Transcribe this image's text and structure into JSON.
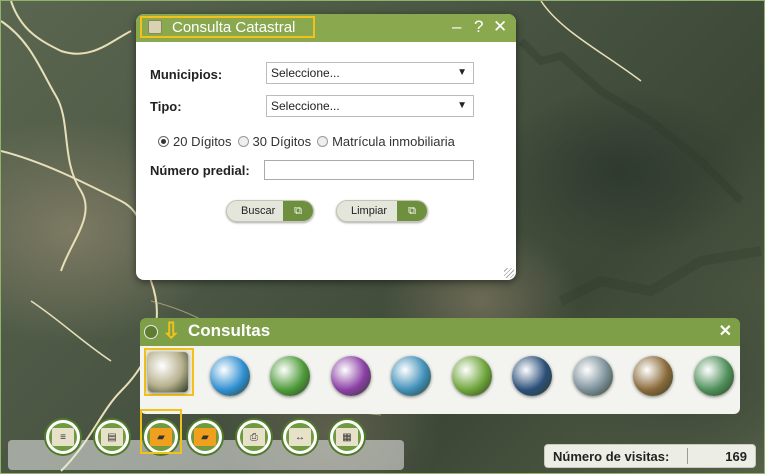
{
  "consulta_catastral": {
    "title": "Consulta Catastral",
    "help_label": "?",
    "minimize_label": "–",
    "close_label": "✕",
    "municipios_label": "Municipios:",
    "municipios_value": "Seleccione...",
    "tipo_label": "Tipo:",
    "tipo_value": "Seleccione...",
    "radio_options": [
      "20 Dígitos",
      "30 Dígitos",
      "Matrícula inmobiliaria"
    ],
    "radio_selected": "20 Dígitos",
    "numero_predial_label": "Número predial:",
    "numero_predial_value": "",
    "buscar_label": "Buscar",
    "limpiar_label": "Limpiar"
  },
  "consultas": {
    "title": "Consultas",
    "close_label": "✕",
    "tools": [
      {
        "name": "consulta-catastral-tool-icon",
        "color": "#b8b28f"
      },
      {
        "name": "search-tool-icon",
        "color": "#2f8fd1"
      },
      {
        "name": "bird-tool-icon",
        "color": "#4e9b39"
      },
      {
        "name": "theater-masks-tool-icon",
        "color": "#8a3fa5"
      },
      {
        "name": "doctor-tool-icon",
        "color": "#3f8fb8"
      },
      {
        "name": "magnifier-road-tool-icon",
        "color": "#6ea53a"
      },
      {
        "name": "network-tool-icon",
        "color": "#2b4f7a"
      },
      {
        "name": "factory-tool-icon",
        "color": "#7b8f99"
      },
      {
        "name": "house-tool-icon",
        "color": "#8a6a3a"
      },
      {
        "name": "people-chart-tool-icon",
        "color": "#4e8f5a"
      }
    ]
  },
  "dock": {
    "buttons": [
      {
        "name": "legend-icon",
        "glyph": "≡"
      },
      {
        "name": "layers-icon",
        "glyph": "▤"
      },
      {
        "name": "consultas-folder-icon",
        "glyph": "▰"
      },
      {
        "name": "open-folder-icon",
        "glyph": "▰"
      },
      {
        "name": "print-icon",
        "glyph": "⎙"
      },
      {
        "name": "measure-icon",
        "glyph": "↔"
      },
      {
        "name": "map-icon",
        "glyph": "▦"
      }
    ]
  },
  "visitas": {
    "label": "Número de visitas:",
    "value": "169"
  },
  "colors": {
    "header_green": "#8aa94f",
    "highlight_yellow": "#f2c21b"
  }
}
